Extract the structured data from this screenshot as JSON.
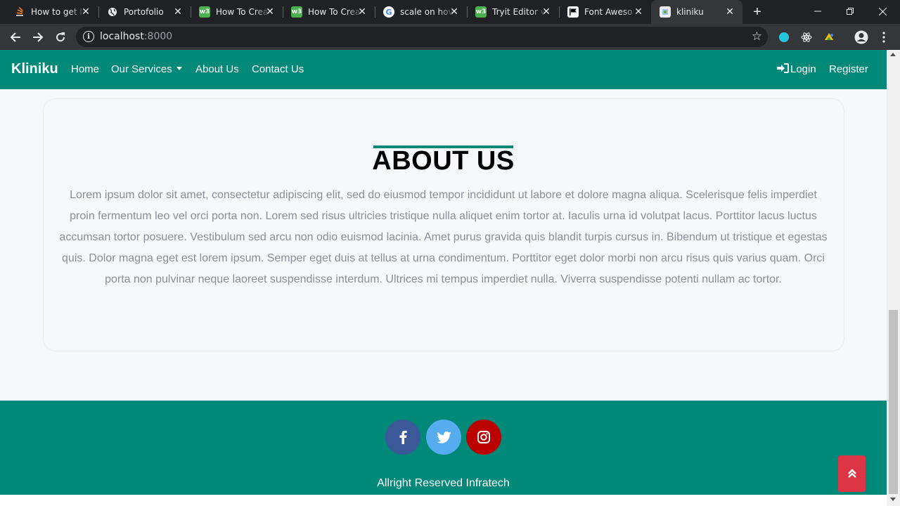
{
  "browser": {
    "tabs": [
      {
        "title": "How to get l",
        "icon": "stackoverflow-icon"
      },
      {
        "title": "Portofolio",
        "icon": "globe-icon"
      },
      {
        "title": "How To Crea",
        "icon": "w3schools-icon"
      },
      {
        "title": "How To Crea",
        "icon": "w3schools-icon"
      },
      {
        "title": "scale on hov",
        "icon": "google-icon"
      },
      {
        "title": "Tryit Editor v",
        "icon": "w3schools-icon"
      },
      {
        "title": "Font Aweso",
        "icon": "fontawesome-flag-icon"
      },
      {
        "title": "kliniku",
        "icon": "page-icon"
      }
    ],
    "url_host": "localhost",
    "url_port": ":8000"
  },
  "navbar": {
    "brand": "Kliniku",
    "links": [
      "Home",
      "Our Services",
      "About Us",
      "Contact Us"
    ],
    "login": "Login",
    "register": "Register"
  },
  "about": {
    "title": "ABOUT US",
    "text": "Lorem ipsum dolor sit amet, consectetur adipiscing elit, sed do eiusmod tempor incididunt ut labore et dolore magna aliqua. Scelerisque felis imperdiet proin fermentum leo vel orci porta non. Lorem sed risus ultricies tristique nulla aliquet enim tortor at. Iaculis urna id volutpat lacus. Porttitor lacus luctus accumsan tortor posuere. Vestibulum sed arcu non odio euismod lacinia. Amet purus gravida quis blandit turpis cursus in. Bibendum ut tristique et egestas quis. Dolor magna eget est lorem ipsum. Semper eget duis at tellus at urna condimentum. Porttitor eget dolor morbi non arcu risus quis varius quam. Orci porta non pulvinar neque laoreet suspendisse interdum. Ultrices mi tempus imperdiet nulla. Viverra suspendisse potenti nullam ac tortor."
  },
  "footer": {
    "social": [
      {
        "icon": "facebook-icon",
        "color": "#3b5998"
      },
      {
        "icon": "twitter-icon",
        "color": "#55acee"
      },
      {
        "icon": "instagram-icon",
        "color": "#bb0000"
      }
    ],
    "copyright": "Allright Reserved Infratech"
  },
  "colors": {
    "brand": "#008878",
    "scroll_top_button": "#dc3545"
  }
}
